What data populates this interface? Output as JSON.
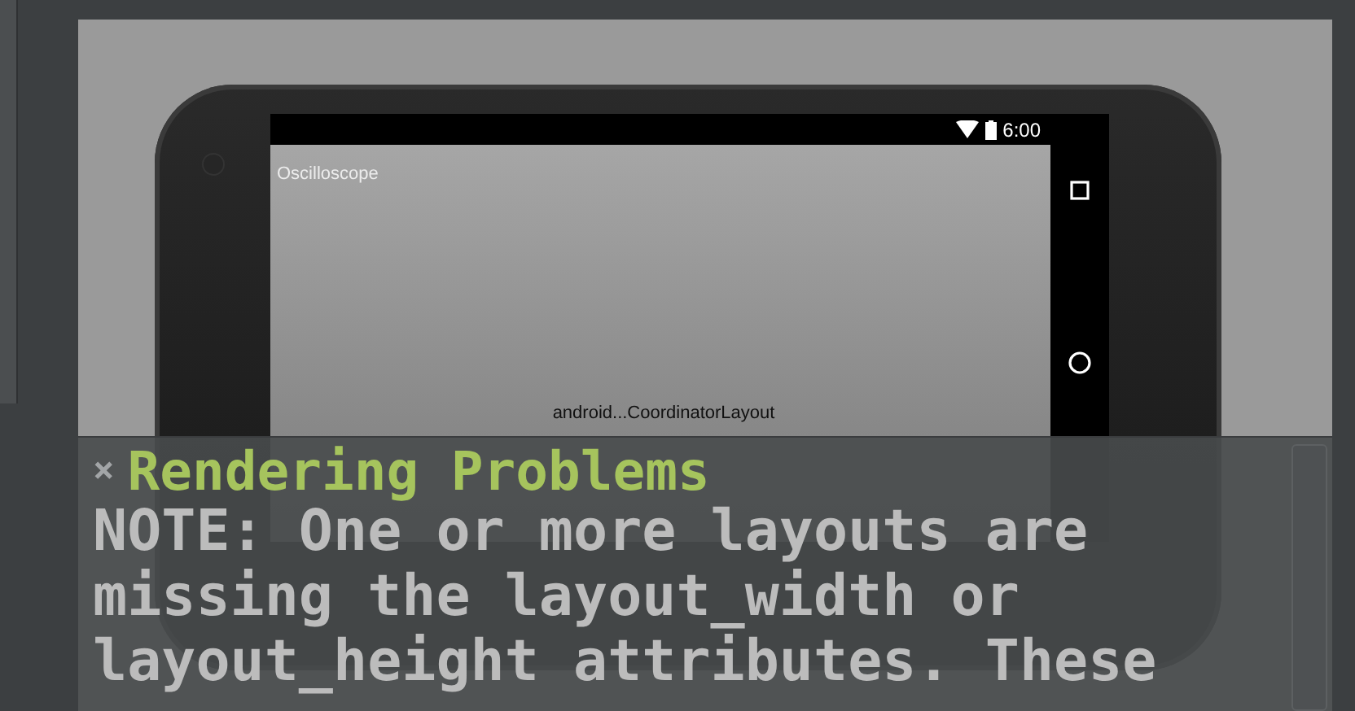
{
  "device": {
    "status_bar": {
      "time": "6:00"
    },
    "app_title": "Oscilloscope",
    "layout_label": "android...CoordinatorLayout"
  },
  "problems_panel": {
    "close": "×",
    "title": "Rendering Problems",
    "message": "NOTE: One or more layouts are missing the layout_width or layout_height attributes. These"
  }
}
